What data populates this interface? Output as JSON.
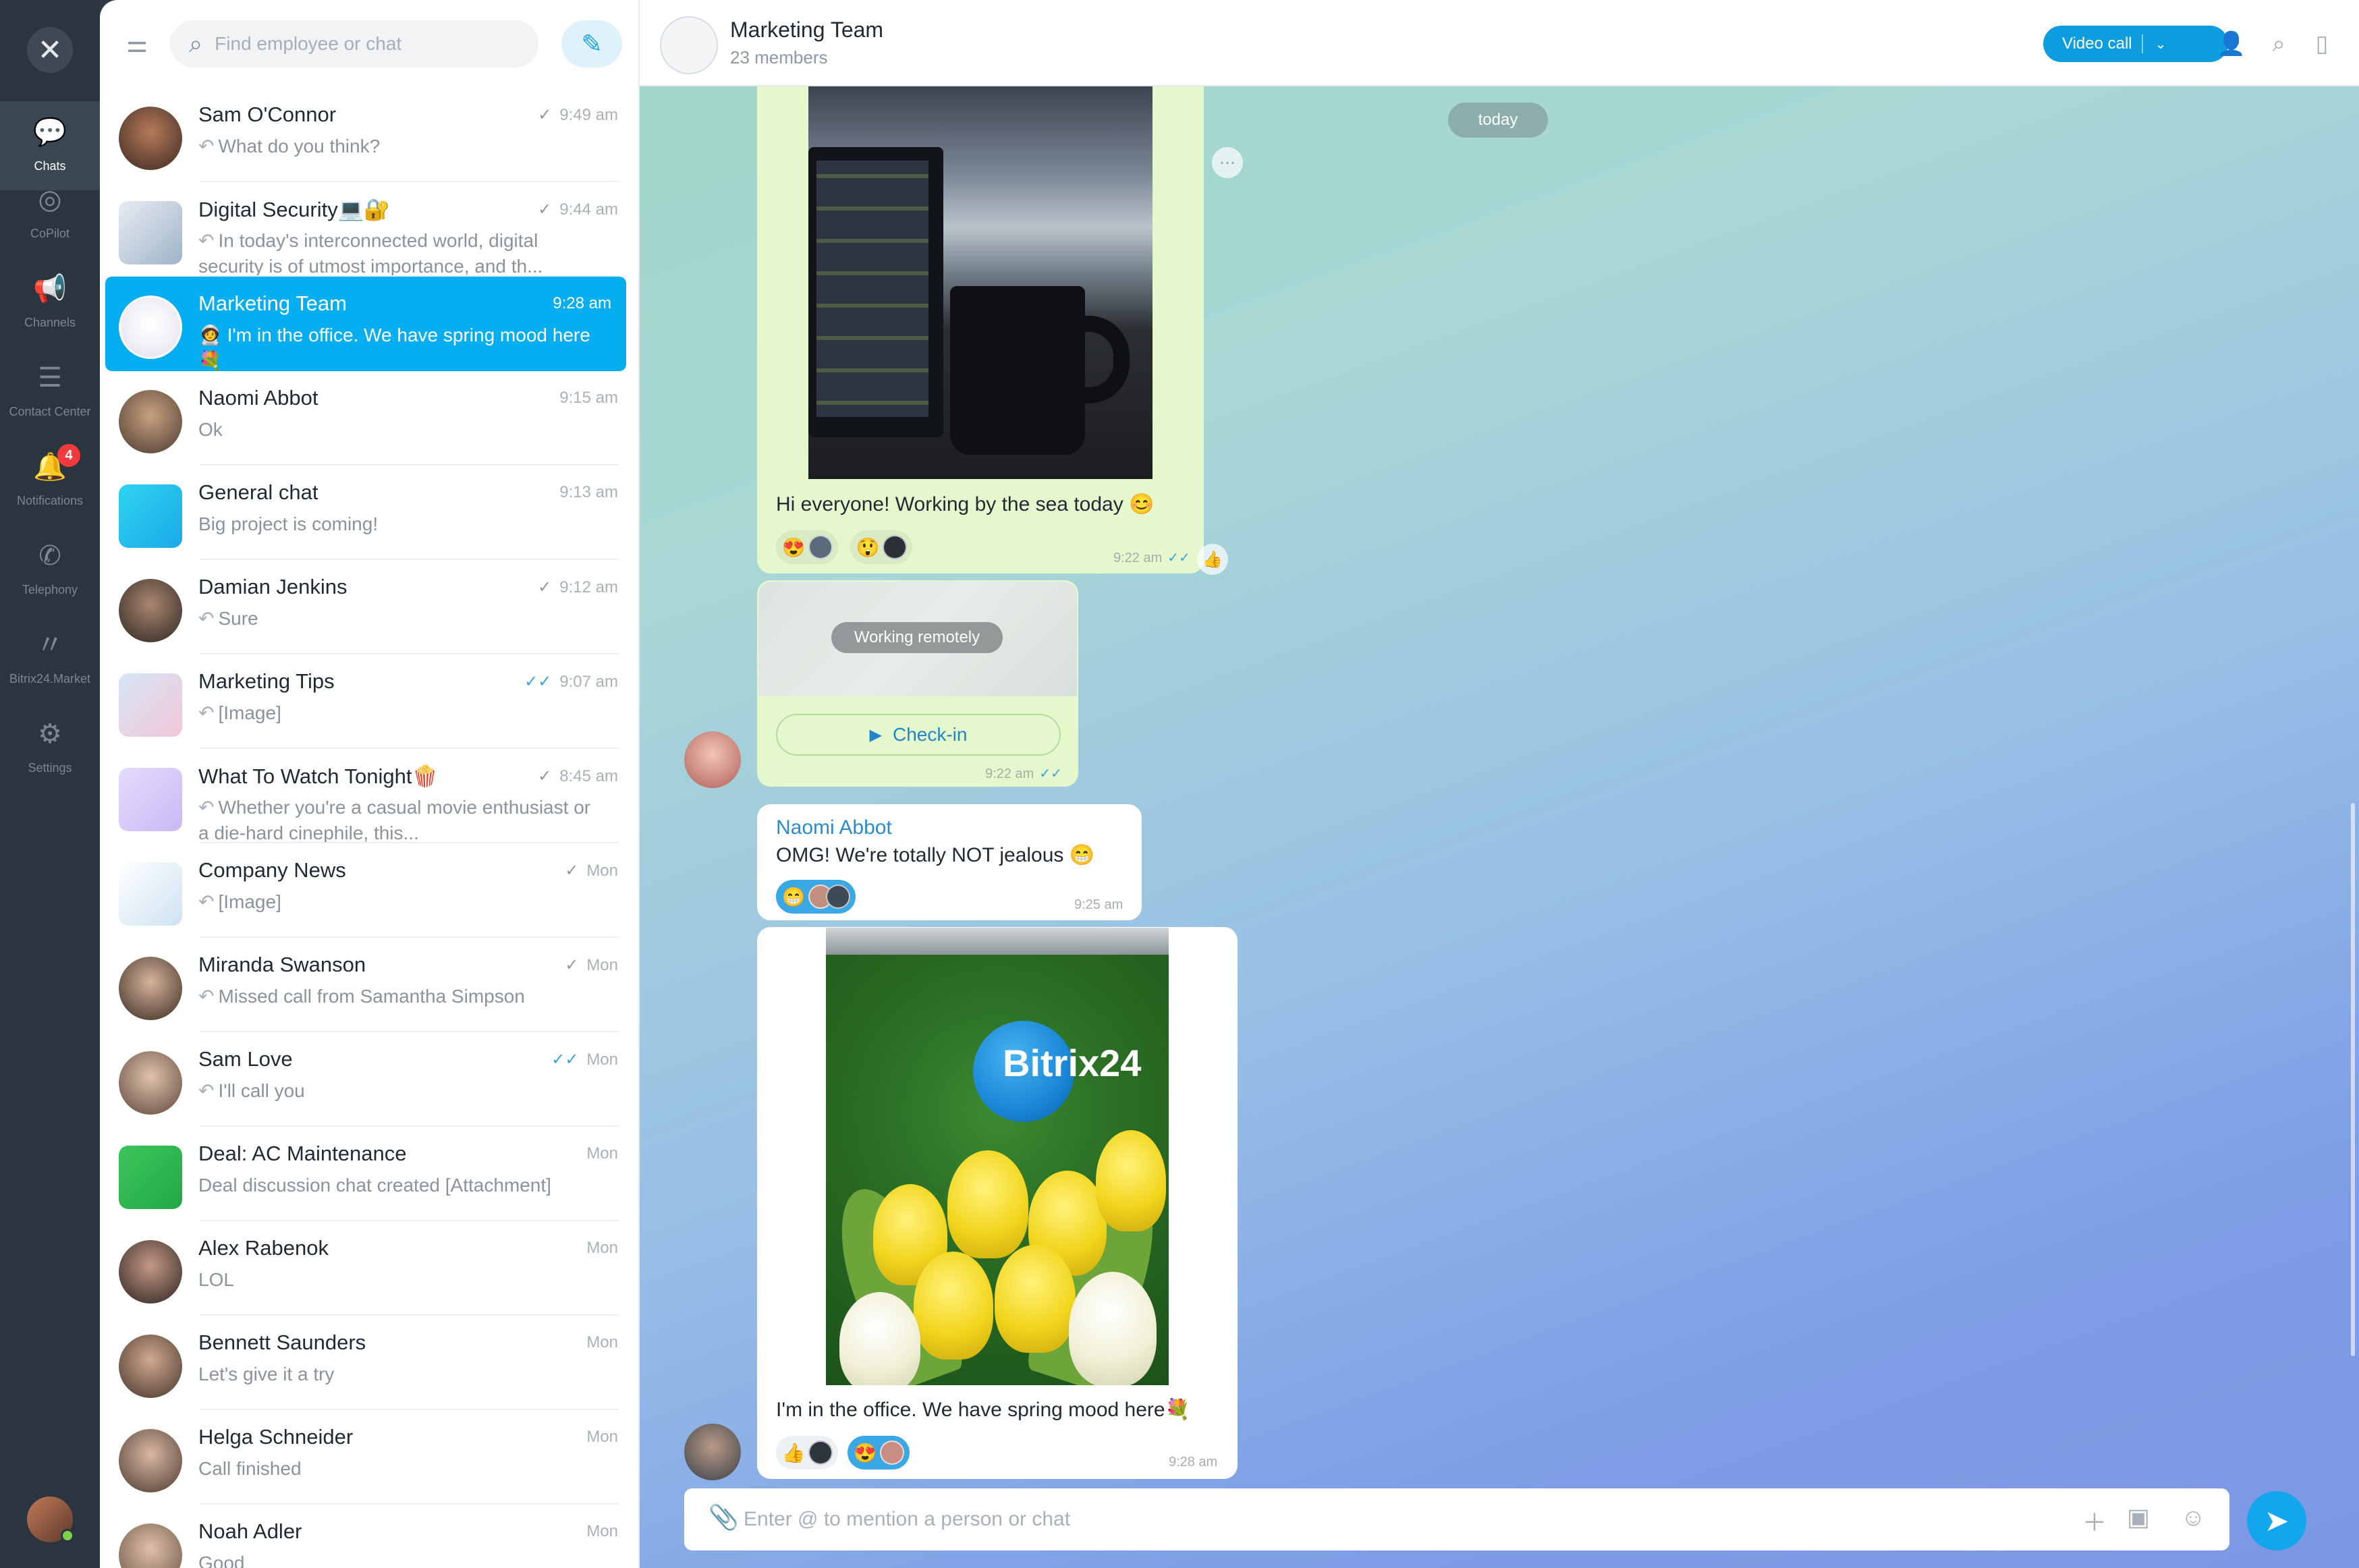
{
  "nav": {
    "items": [
      {
        "label": "Chats",
        "icon": "chats-icon",
        "glyph": "💬"
      },
      {
        "label": "CoPilot",
        "icon": "copilot-icon",
        "glyph": "◎"
      },
      {
        "label": "Channels",
        "icon": "channels-icon",
        "glyph": "📢"
      },
      {
        "label": "Contact Center",
        "icon": "contact-center-icon",
        "glyph": "☰"
      },
      {
        "label": "Notifications",
        "icon": "bell-icon",
        "glyph": "🔔",
        "badge": "4"
      },
      {
        "label": "Telephony",
        "icon": "phone-icon",
        "glyph": "✆"
      },
      {
        "label": "Bitrix24.Market",
        "icon": "market-icon",
        "glyph": "〃"
      },
      {
        "label": "Settings",
        "icon": "gear-icon",
        "glyph": "⚙"
      }
    ]
  },
  "search": {
    "placeholder": "Find employee or chat"
  },
  "chats": [
    {
      "name": "Sam O'Connor",
      "time": "9:49 am",
      "check": "single",
      "reply": true,
      "preview": "What do you think?"
    },
    {
      "name": "Digital Security💻🔐",
      "time": "9:44 am",
      "check": "single",
      "reply": true,
      "preview": "In today's interconnected world, digital security is of utmost importance, and th..."
    },
    {
      "name": "Marketing Team",
      "time": "9:28 am",
      "check": "",
      "reply": false,
      "preview": "🧑‍🚀 I'm in the office. We have spring mood here💐",
      "active": true
    },
    {
      "name": "Naomi Abbot",
      "time": "9:15 am",
      "check": "",
      "reply": false,
      "preview": "Ok"
    },
    {
      "name": "General chat",
      "time": "9:13 am",
      "check": "",
      "reply": false,
      "preview": "Big project is coming!"
    },
    {
      "name": "Damian Jenkins",
      "time": "9:12 am",
      "check": "single",
      "reply": true,
      "preview": "Sure"
    },
    {
      "name": "Marketing Tips",
      "time": "9:07 am",
      "check": "double",
      "reply": true,
      "preview": "[Image]"
    },
    {
      "name": "What To Watch Tonight🍿",
      "time": "8:45 am",
      "check": "single",
      "reply": true,
      "preview": "Whether you're a casual movie enthusiast or a die-hard cinephile, this..."
    },
    {
      "name": "Company News",
      "time": "Mon",
      "check": "single",
      "reply": true,
      "preview": "[Image]"
    },
    {
      "name": "Miranda Swanson",
      "time": "Mon",
      "check": "single",
      "reply": true,
      "preview": "Missed call from Samantha Simpson"
    },
    {
      "name": "Sam Love",
      "time": "Mon",
      "check": "double",
      "reply": true,
      "preview": "I'll call you"
    },
    {
      "name": "Deal: AC Maintenance",
      "time": "Mon",
      "check": "",
      "reply": false,
      "preview": "Deal discussion chat created [Attachment]"
    },
    {
      "name": "Alex Rabenok",
      "time": "Mon",
      "check": "",
      "reply": false,
      "preview": "LOL"
    },
    {
      "name": "Bennett Saunders",
      "time": "Mon",
      "check": "",
      "reply": false,
      "preview": "Let's give it a try"
    },
    {
      "name": "Helga Schneider",
      "time": "Mon",
      "check": "",
      "reply": false,
      "preview": "Call finished"
    },
    {
      "name": "Noah Adler",
      "time": "Mon",
      "check": "",
      "reply": false,
      "preview": "Good"
    }
  ],
  "header": {
    "title": "Marketing Team",
    "subtitle": "23 members",
    "video_call": "Video call"
  },
  "messages": {
    "date_divider": "today",
    "m1": {
      "text": "Hi everyone! Working by the sea today 😊",
      "time": "9:22 am"
    },
    "m2": {
      "location_label": "Working remotely",
      "button": "Check-in",
      "time": "9:22 am"
    },
    "m3": {
      "author": "Naomi Abbot",
      "text": "OMG! We're totally NOT jealous 😁",
      "time": "9:25 am"
    },
    "m4": {
      "text": "I'm in the office. We have spring mood here💐",
      "time": "9:28 am",
      "logo_text": "Bitrix24"
    }
  },
  "composer": {
    "placeholder": "Enter @ to mention a person or chat"
  },
  "colors": {
    "accent": "#05aef0",
    "rail": "#2b3540",
    "own_bubble": "#e4f7cd"
  }
}
